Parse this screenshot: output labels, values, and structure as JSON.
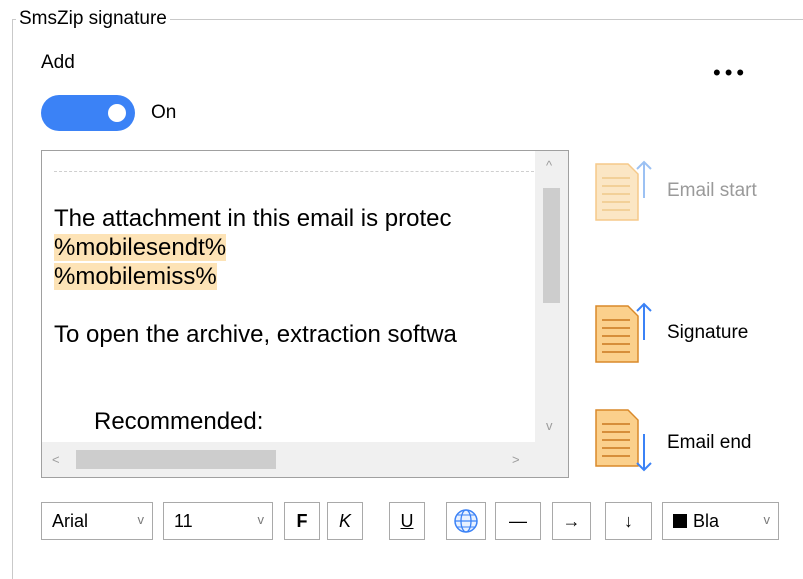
{
  "group": {
    "title": "SmsZip signature"
  },
  "add": {
    "label": "Add",
    "toggle_state": "On",
    "toggle_on": true
  },
  "more_label": "•••",
  "editor": {
    "lines": [
      {
        "text": "The attachment in this email is protec",
        "highlight": false
      },
      {
        "text": "%mobilesendt%",
        "highlight": true
      },
      {
        "text": "%mobilemiss%",
        "highlight": true
      },
      {
        "text": "",
        "highlight": false
      },
      {
        "text": "To open the archive, extraction softwa",
        "highlight": false
      },
      {
        "text": "",
        "highlight": false
      },
      {
        "text": "    Recommended:",
        "highlight": false
      }
    ]
  },
  "positions": {
    "email_start": "Email start",
    "signature": "Signature",
    "email_end": "Email end"
  },
  "toolbar": {
    "font": "Arial",
    "size": "11",
    "bold": "F",
    "italic": "K",
    "underline": "U",
    "hr": "—",
    "indent": "→",
    "linebreak": "↓",
    "color": "Bla"
  },
  "colors": {
    "accent": "#3b82f6",
    "highlight": "#fde3b6",
    "doc_fill": "#fbd08c",
    "arrow": "#3b82f6"
  }
}
